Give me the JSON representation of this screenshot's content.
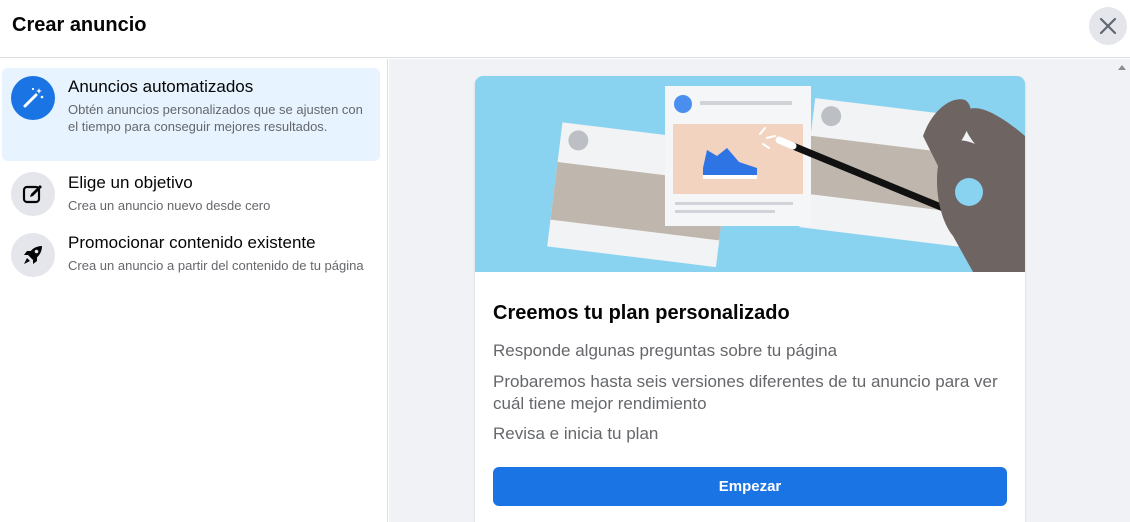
{
  "header": {
    "title": "Crear anuncio"
  },
  "sidebar": {
    "options": [
      {
        "title": "Anuncios automatizados",
        "description": "Obtén anuncios personalizados que se ajusten con el tiempo para conseguir mejores resultados.",
        "icon": "magic-wand-icon",
        "selected": true
      },
      {
        "title": "Elige un objetivo",
        "description": "Crea un anuncio nuevo desde cero",
        "icon": "edit-icon",
        "selected": false
      },
      {
        "title": "Promocionar contenido existente",
        "description": "Crea un anuncio a partir del contenido de tu página",
        "icon": "rocket-icon",
        "selected": false
      }
    ]
  },
  "main": {
    "card": {
      "title": "Creemos tu plan personalizado",
      "lines": [
        "Responde algunas preguntas sobre tu página",
        "Probaremos hasta seis versiones diferentes de tu anuncio para ver cuál tiene mejor rendimiento",
        "Revisa e inicia tu plan"
      ],
      "button_label": "Empezar"
    }
  },
  "colors": {
    "accent": "#1b74e4",
    "selected_bg": "#e7f3ff",
    "illustration_bg": "#8ad3f0"
  }
}
